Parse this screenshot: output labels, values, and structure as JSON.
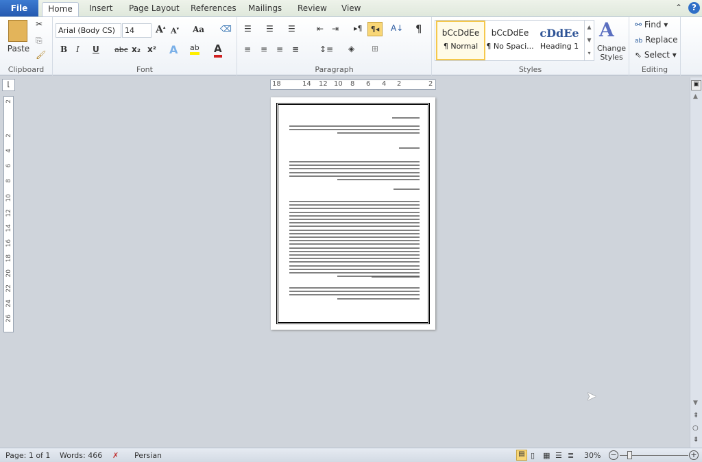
{
  "tabs": {
    "file": "File",
    "home": "Home",
    "insert": "Insert",
    "page_layout": "Page Layout",
    "references": "References",
    "mailings": "Mailings",
    "review": "Review",
    "view": "View"
  },
  "clipboard": {
    "paste": "Paste",
    "label": "Clipboard"
  },
  "font": {
    "name": "Arial (Body CS)",
    "size": "14",
    "label": "Font",
    "change_case": "Aa",
    "bold": "B",
    "italic": "I",
    "underline": "U",
    "strike": "abc",
    "sub": "x₂",
    "sup": "x²"
  },
  "paragraph": {
    "label": "Paragraph",
    "pilcrow": "¶"
  },
  "styles": {
    "label": "Styles",
    "items": [
      {
        "preview": "bCcDdEe",
        "name": "¶ Normal"
      },
      {
        "preview": "bCcDdEe",
        "name": "¶ No Spaci..."
      },
      {
        "preview": "cDdEe",
        "name": "Heading 1"
      }
    ],
    "change_styles": "Change Styles"
  },
  "editing": {
    "label": "Editing",
    "find": "Find",
    "replace": "Replace",
    "select": "Select"
  },
  "ruler_h": [
    "18",
    "14",
    "12",
    "10",
    "8",
    "6",
    "4",
    "2",
    "2"
  ],
  "ruler_v": [
    "2",
    "2",
    "4",
    "6",
    "8",
    "10",
    "12",
    "14",
    "16",
    "18",
    "20",
    "22",
    "24",
    "26"
  ],
  "status": {
    "page": "Page: 1 of 1",
    "words": "Words: 466",
    "language": "Persian",
    "zoom": "30%"
  },
  "colors": {
    "accent": "#2459b0",
    "selected_style": "#f5c84c"
  }
}
